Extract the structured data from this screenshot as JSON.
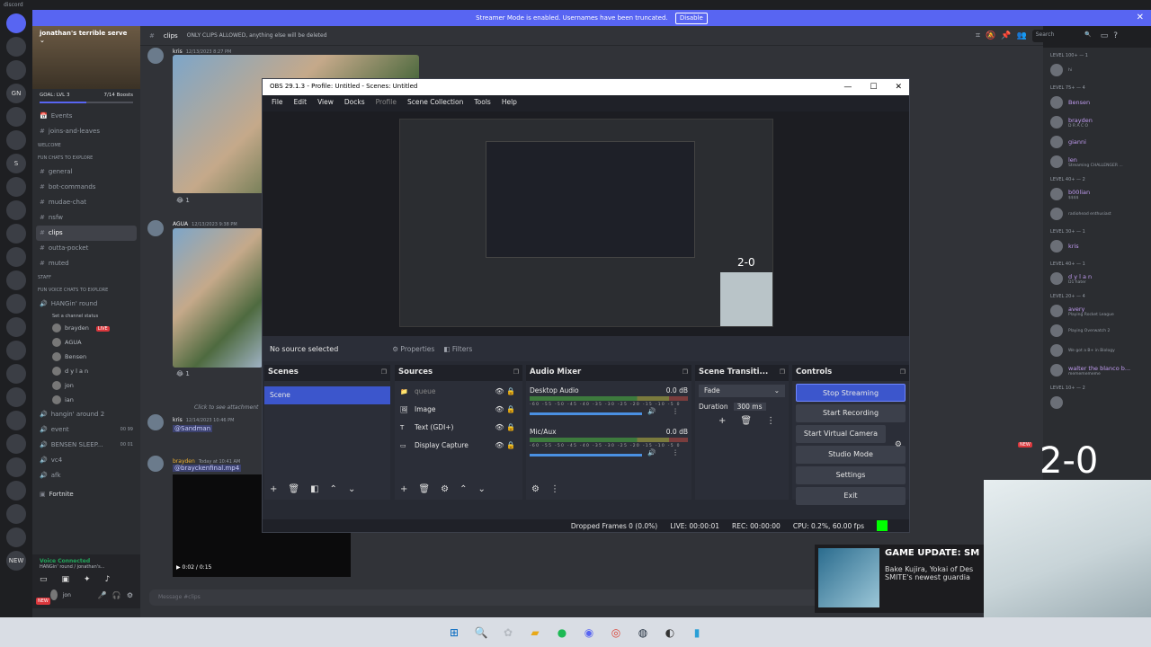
{
  "window": {
    "app": "discord"
  },
  "banner": {
    "text": "Streamer Mode is enabled. Usernames have been truncated.",
    "disable": "Disable",
    "close": "✕"
  },
  "guilds": [
    "",
    "",
    "",
    "GN",
    "",
    "",
    "S",
    "",
    "",
    "",
    "",
    "",
    "",
    "",
    "",
    "",
    "",
    "",
    "",
    "",
    "",
    "",
    "",
    "NEW"
  ],
  "server": {
    "name": "jonathan's terrible serve",
    "goal": "GOAL: LVL 3",
    "boosts": "7/14 Boosts"
  },
  "channels": [
    {
      "type": "item",
      "icon": "📅",
      "label": "Events"
    },
    {
      "type": "ch",
      "label": "joins-and-leaves"
    },
    {
      "type": "cat",
      "label": "WELCOME"
    },
    {
      "type": "cat",
      "label": "FUN CHATS TO EXPLORE"
    },
    {
      "type": "ch",
      "label": "general"
    },
    {
      "type": "ch",
      "label": "bot-commands"
    },
    {
      "type": "ch",
      "label": "mudae-chat"
    },
    {
      "type": "ch",
      "label": "nsfw"
    },
    {
      "type": "chsel",
      "label": "clips"
    },
    {
      "type": "ch",
      "label": "outta-pocket"
    },
    {
      "type": "ch",
      "label": "muted"
    },
    {
      "type": "cat",
      "label": "STAFF"
    },
    {
      "type": "cat",
      "label": "FUN VOICE CHATS TO EXPLORE"
    },
    {
      "type": "voice",
      "label": "HANGin' round"
    },
    {
      "type": "sub",
      "label": "Set a channel status"
    }
  ],
  "voice_users": [
    {
      "name": "brayden",
      "live": "LIVE"
    },
    {
      "name": "AGUA",
      "live": ""
    },
    {
      "name": "Bensen",
      "live": ""
    },
    {
      "name": "d y l a n",
      "live": ""
    },
    {
      "name": "jon",
      "live": ""
    },
    {
      "name": "ian",
      "live": ""
    }
  ],
  "channels2": [
    "hangin' around 2",
    "event",
    "BENSEN SLEEP...",
    "vc4",
    "afk"
  ],
  "channels2_counts": [
    "",
    "00  99",
    "00  01",
    "",
    ""
  ],
  "fortnite": "Fortnite",
  "vconn": {
    "status": "Voice Connected",
    "sub": "HANGin' round / jonathan's...",
    "user": "jon"
  },
  "chat": {
    "channel": "clips",
    "topic": "ONLY CLIPS ALLOWED, anything else will be deleted",
    "m1": {
      "name": "kris",
      "ts": "12/13/2023 8:27 PM",
      "reaction": "1"
    },
    "m2": {
      "name": "AGUA",
      "ts": "12/13/2023 9:38 PM",
      "reaction": "1"
    },
    "m3": {
      "name": "kris",
      "ts": "12/14/2023 10:46 PM",
      "reply": "Click to see attachment",
      "mention": "@Sandman"
    },
    "m4": {
      "name": "brayden",
      "ts": "Today at 10:41 AM",
      "file": "@brayckenfinal.mp4",
      "time": "0:02 / 0:15"
    },
    "newtag": "NEW",
    "message_placeholder": "Message #clips"
  },
  "search": "Search",
  "members": [
    {
      "lvl": "LEVEL 100+ — 1",
      "name": "",
      "status": "hi"
    },
    {
      "lvl": "LEVEL 75+ — 4",
      "name": "Bensen",
      "status": ""
    },
    {
      "lvl": "",
      "name": "brayden",
      "status": "D R A C O"
    },
    {
      "lvl": "",
      "name": "gianni",
      "status": ""
    },
    {
      "lvl": "",
      "name": "len",
      "status": "Streaming CHALLENGER ..."
    },
    {
      "lvl": "LEVEL 40+ — 2",
      "name": "b00lian",
      "status": "$$$$"
    },
    {
      "lvl": "",
      "name": "",
      "status": "radiohead enthusiast"
    },
    {
      "lvl": "LEVEL 30+ — 1",
      "name": "kris",
      "status": ""
    },
    {
      "lvl": "LEVEL 40+ — 1",
      "name": "d y l a n",
      "status": "D1 hater"
    },
    {
      "lvl": "LEVEL 20+ — 4",
      "name": "avery",
      "status": "Playing Rocket League"
    },
    {
      "lvl": "",
      "name": "",
      "status": "Playing Overwatch 2"
    },
    {
      "lvl": "",
      "name": "",
      "status": "We got a B+ in Biology"
    },
    {
      "lvl": "",
      "name": "walter the blanco b...",
      "status": "mememememe"
    },
    {
      "lvl": "LEVEL 10+ — 2",
      "name": "",
      "status": ""
    }
  ],
  "obs": {
    "title": "OBS 29.1.3 - Profile: Untitled - Scenes: Untitled",
    "menu": [
      "File",
      "Edit",
      "View",
      "Docks",
      "Profile",
      "Scene Collection",
      "Tools",
      "Help"
    ],
    "no_source": "No source selected",
    "properties": "Properties",
    "filters": "Filters",
    "docks": {
      "scenes": "Scenes",
      "sources": "Sources",
      "mixer": "Audio Mixer",
      "transitions": "Scene Transiti...",
      "controls": "Controls"
    },
    "scenes": [
      "Scene"
    ],
    "sources": [
      {
        "name": "queue",
        "icon": "📁"
      },
      {
        "name": "Image",
        "icon": "🖼"
      },
      {
        "name": "Text (GDI+)",
        "icon": "T"
      },
      {
        "name": "Display Capture",
        "icon": "▭"
      }
    ],
    "mixer": [
      {
        "name": "Desktop Audio",
        "db": "0.0 dB"
      },
      {
        "name": "Mic/Aux",
        "db": "0.0 dB"
      }
    ],
    "scale": "-60 -55 -50 -45 -40 -35 -30 -25 -20 -15 -10 -5 0",
    "transition": {
      "type": "Fade",
      "duration_label": "Duration",
      "duration": "300 ms"
    },
    "controls": {
      "stream": "Stop Streaming",
      "record": "Start Recording",
      "vcam": "Start Virtual Camera",
      "studio": "Studio Mode",
      "settings": "Settings",
      "exit": "Exit"
    },
    "status": {
      "dropped": "Dropped Frames 0 (0.0%)",
      "live": "LIVE: 00:00:01",
      "rec": "REC: 00:00:00",
      "cpu": "CPU: 0.2%, 60.00 fps"
    },
    "overlay_score": "2-0"
  },
  "overlay": {
    "score": "2-0"
  },
  "notification": {
    "title": "GAME UPDATE: SMITE",
    "desc1": "Bake Kujira, Yokai of Des",
    "desc2": "SMITE's newest guardia"
  },
  "colors": {
    "accent": "#5865f2",
    "obs_blue": "#3c56cc",
    "live_green": "#00ff00"
  }
}
